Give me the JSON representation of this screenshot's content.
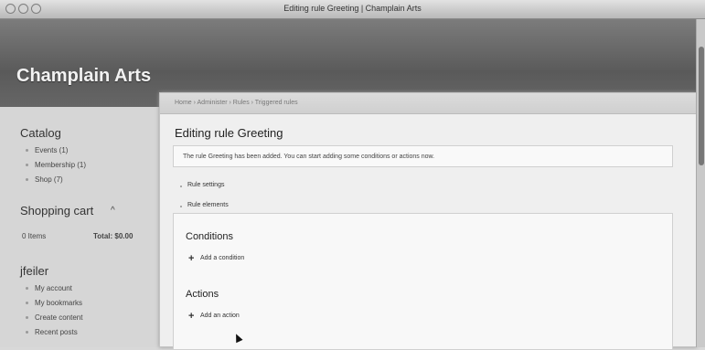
{
  "window": {
    "title": "Editing rule Greeting | Champlain Arts"
  },
  "site": {
    "name": "Champlain Arts"
  },
  "sidebar": {
    "catalog": {
      "title": "Catalog",
      "items": [
        "Events (1)",
        "Membership (1)",
        "Shop (7)"
      ]
    },
    "cart": {
      "title": "Shopping cart",
      "toggle_icon": "caret-up-icon",
      "items_label": "0 Items",
      "total_label": "Total: $0.00"
    },
    "user": {
      "title": "jfeiler",
      "items": [
        "My account",
        "My bookmarks",
        "Create content",
        "Recent posts"
      ]
    }
  },
  "breadcrumb": "Home › Administer › Rules › Triggered rules",
  "main": {
    "title": "Editing rule Greeting",
    "status_message": "The rule Greeting has been added. You can start adding some conditions or actions now.",
    "tabs": [
      "Rule settings",
      "Rule elements"
    ],
    "conditions": {
      "title": "Conditions",
      "add_label": "Add a condition"
    },
    "actions": {
      "title": "Actions",
      "add_label": "Add an action"
    }
  }
}
